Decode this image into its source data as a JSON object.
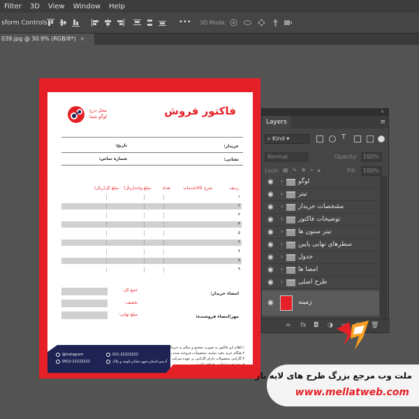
{
  "menu": [
    "Filter",
    "3D",
    "View",
    "Window",
    "Help"
  ],
  "options": {
    "transform_label": "sform Controls",
    "more": "•••",
    "mode_label": "3D Mode:"
  },
  "tab": {
    "title": "039.jpg @ 30.9% (RGB/8*)",
    "close": "×"
  },
  "invoice": {
    "title": "فاکتور فروش",
    "logo_text_1": "محل درج",
    "logo_text_2": "لوگو شما",
    "buyer": "خریدار:",
    "date": "تاریخ:",
    "address": "نشانی:",
    "contact_number": "شماره تماس:",
    "columns": [
      "ردیف",
      "شرح کالا/خدمات",
      "تعداد",
      "مبلغ واحد(ریال)",
      "مبلغ کل(ریال)"
    ],
    "row_numbers": [
      "۱",
      "۲",
      "۳",
      "۴",
      "۵",
      "۶",
      "۷",
      "۸",
      "۹"
    ],
    "total": "جمع کل:",
    "discount": "تخفیف:",
    "final_amount": "مبلغ نهایی:",
    "buyer_signature": "امضاء خریدار:",
    "seller_signature": "مهر/امضاء فروشنده:",
    "terms": [
      "۱.اقلام این فاکتور به صورت صحیح و سالم به خریدار تحویل گردید.",
      "۲.هنگام خرید دقت نمایید، محصولات فروخته شده پس گرفته نمی شود.",
      "۳.گارانتی محصولات دارای گارانتی بر عهده شرکت گارانتی کننده بوده و",
      "فروشنده مسئولیتی نخواهد داشت."
    ],
    "instagram": "@instagram",
    "phone_1": "021-22222222",
    "phone_2": "0912-22222222",
    "address_line": "آدرس:استان،شهر،خیابان،کوچه و پلاک"
  },
  "layers_panel": {
    "tab": "Layers",
    "kind": "Kind",
    "blend_mode": "Normal",
    "opacity_label": "Opacity:",
    "opacity_value": "100%",
    "lock_label": "Lock:",
    "fill_label": "Fill:",
    "fill_value": "100%",
    "layers": [
      "لوگو",
      "تیتر",
      "مشخصات خریدار",
      "توضیحات فاکتور",
      "تیتر ستون ها",
      "سطرهای نهایی پایین",
      "جدول",
      "امضا ها",
      "طرح اصلی"
    ],
    "background_layer": "زمینه",
    "background_color": "#e52027"
  },
  "watermark": {
    "title": "ملت وب مرجع بزرگ طرح های لایه باز",
    "url": "www.mellatweb.com"
  },
  "colors": {
    "accent": "#e52027",
    "navy": "#1e2353"
  }
}
